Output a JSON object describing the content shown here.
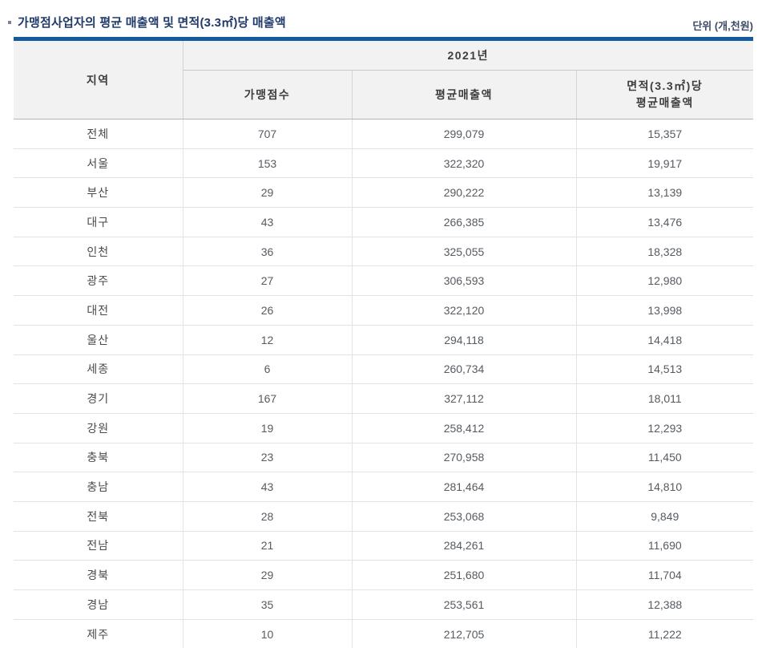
{
  "page": {
    "title": "가맹점사업자의 평균 매출액 및 면적(3.3㎡)당 매출액",
    "unit_label": "단위 (개,천원)"
  },
  "colors": {
    "accent_border_blue": "#155a9e",
    "title_navy": "#1f3a68",
    "header_background": "#f2f2f2",
    "table_bottom_border": "#adadad"
  },
  "table": {
    "headers": {
      "region": "지역",
      "year_group": "2021년",
      "store_count": "가맹점수",
      "avg_sales": "평균매출액",
      "per_area_line1": "면적(3.3㎡)당",
      "per_area_line2": "평균매출액"
    },
    "rows": [
      {
        "region": "전체",
        "count": "707",
        "avg": "299,079",
        "per_area": "15,357"
      },
      {
        "region": "서울",
        "count": "153",
        "avg": "322,320",
        "per_area": "19,917"
      },
      {
        "region": "부산",
        "count": "29",
        "avg": "290,222",
        "per_area": "13,139"
      },
      {
        "region": "대구",
        "count": "43",
        "avg": "266,385",
        "per_area": "13,476"
      },
      {
        "region": "인천",
        "count": "36",
        "avg": "325,055",
        "per_area": "18,328"
      },
      {
        "region": "광주",
        "count": "27",
        "avg": "306,593",
        "per_area": "12,980"
      },
      {
        "region": "대전",
        "count": "26",
        "avg": "322,120",
        "per_area": "13,998"
      },
      {
        "region": "울산",
        "count": "12",
        "avg": "294,118",
        "per_area": "14,418"
      },
      {
        "region": "세종",
        "count": "6",
        "avg": "260,734",
        "per_area": "14,513"
      },
      {
        "region": "경기",
        "count": "167",
        "avg": "327,112",
        "per_area": "18,011"
      },
      {
        "region": "강원",
        "count": "19",
        "avg": "258,412",
        "per_area": "12,293"
      },
      {
        "region": "충북",
        "count": "23",
        "avg": "270,958",
        "per_area": "11,450"
      },
      {
        "region": "충남",
        "count": "43",
        "avg": "281,464",
        "per_area": "14,810"
      },
      {
        "region": "전북",
        "count": "28",
        "avg": "253,068",
        "per_area": "9,849"
      },
      {
        "region": "전남",
        "count": "21",
        "avg": "284,261",
        "per_area": "11,690"
      },
      {
        "region": "경북",
        "count": "29",
        "avg": "251,680",
        "per_area": "11,704"
      },
      {
        "region": "경남",
        "count": "35",
        "avg": "253,561",
        "per_area": "12,388"
      },
      {
        "region": "제주",
        "count": "10",
        "avg": "212,705",
        "per_area": "11,222"
      }
    ]
  }
}
